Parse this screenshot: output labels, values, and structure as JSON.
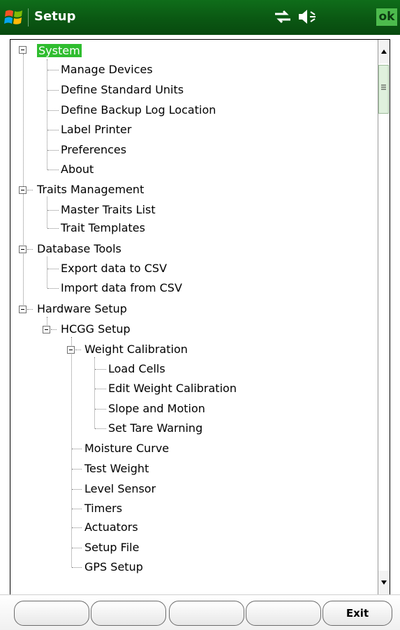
{
  "titlebar": {
    "title": "Setup",
    "ok_label": "ok"
  },
  "tree": {
    "system": "System",
    "system_children": [
      "Manage Devices",
      "Define Standard Units",
      "Define Backup Log Location",
      "Label Printer",
      "Preferences",
      "About"
    ],
    "traits": "Traits Management",
    "traits_children": [
      "Master Traits List",
      "Trait Templates"
    ],
    "database": "Database Tools",
    "database_children": [
      "Export data to CSV",
      "Import data from CSV"
    ],
    "hardware": "Hardware Setup",
    "hcgg": "HCGG Setup",
    "weight": "Weight Calibration",
    "weight_children": [
      "Load Cells",
      "Edit Weight Calibration",
      "Slope and Motion",
      "Set Tare Warning"
    ],
    "hcgg_children": [
      "Moisture Curve",
      "Test Weight",
      "Level Sensor",
      "Timers",
      "Actuators",
      "Setup File",
      "GPS Setup"
    ]
  },
  "softkeys": [
    "",
    "",
    "",
    "",
    "Exit"
  ],
  "colors": {
    "titlebar": "#0a5612",
    "selection": "#2fbd2f",
    "ok_bg": "#4dbb4d"
  }
}
